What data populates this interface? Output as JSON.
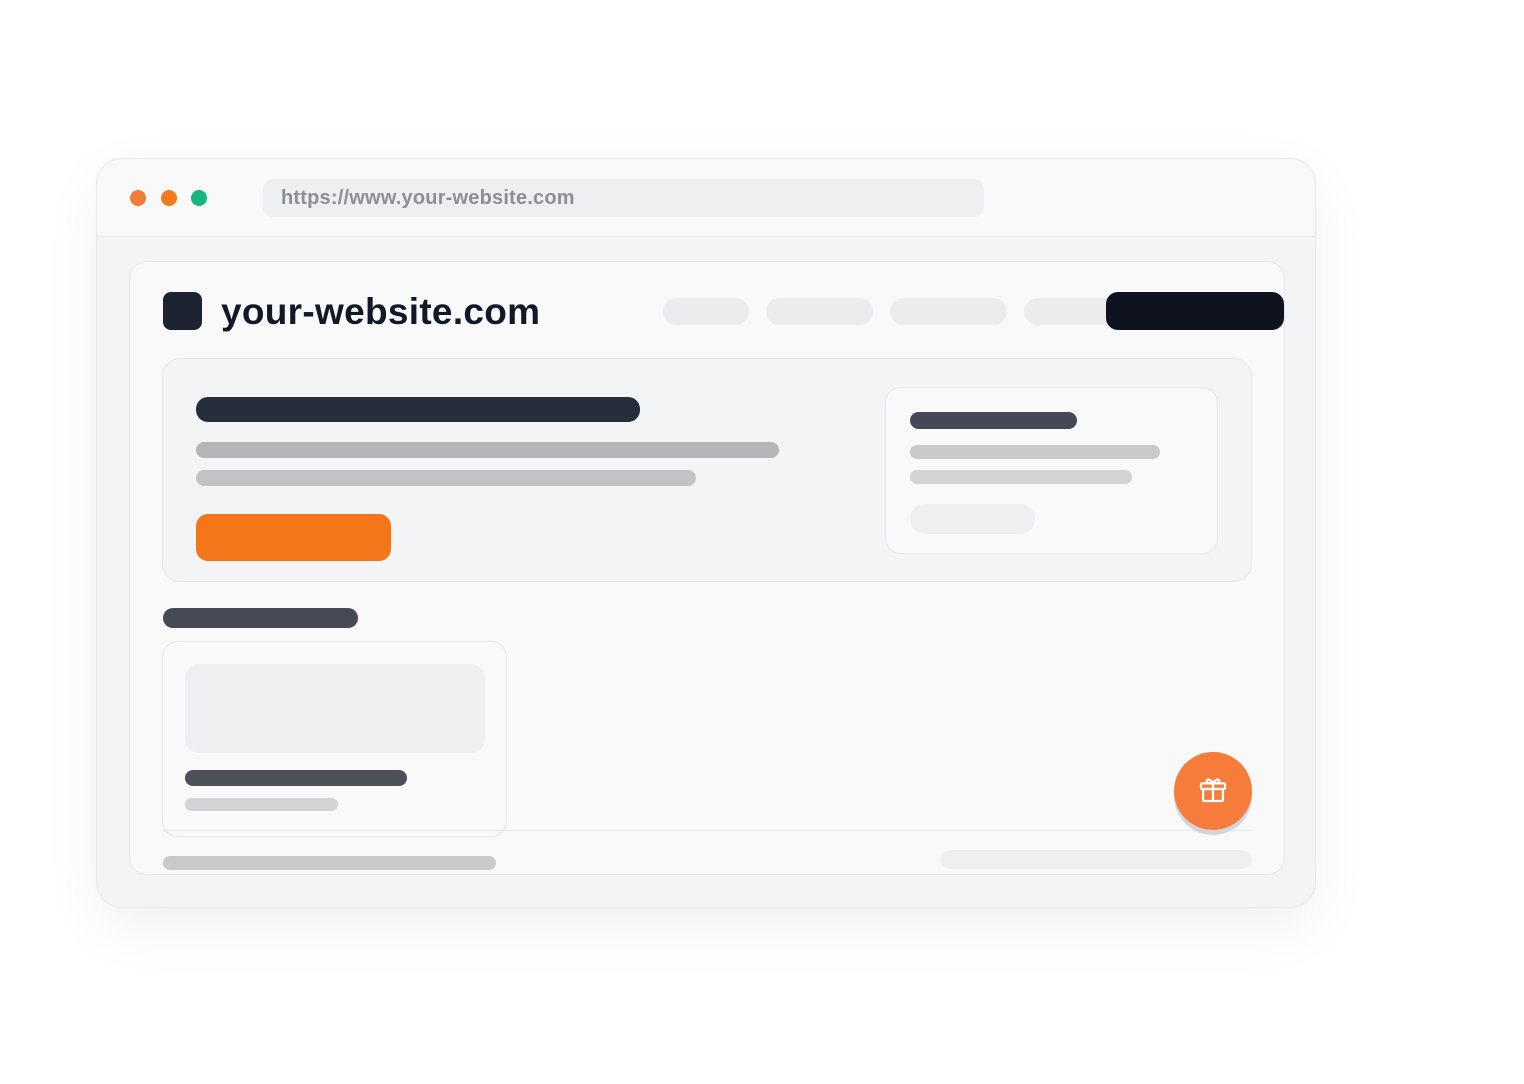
{
  "browser": {
    "url": "https://www.your-website.com",
    "window_controls": [
      "close",
      "minimize",
      "maximize"
    ]
  },
  "site": {
    "title": "your-website.com",
    "logo": "square-logo",
    "nav_items_count": 4,
    "cta": "primary-dark-button"
  },
  "hero": {
    "cta_color": "#f47618",
    "side_card": "info-card"
  },
  "section": {
    "card": "product-card"
  },
  "fab": {
    "icon": "gift-icon",
    "color": "#f57c3a"
  },
  "colors": {
    "accent": "#f47618",
    "dark": "#0f1320",
    "close_dot": "#f47b3a",
    "minimize_dot": "#f47b1c",
    "maximize_dot": "#18b57f"
  }
}
